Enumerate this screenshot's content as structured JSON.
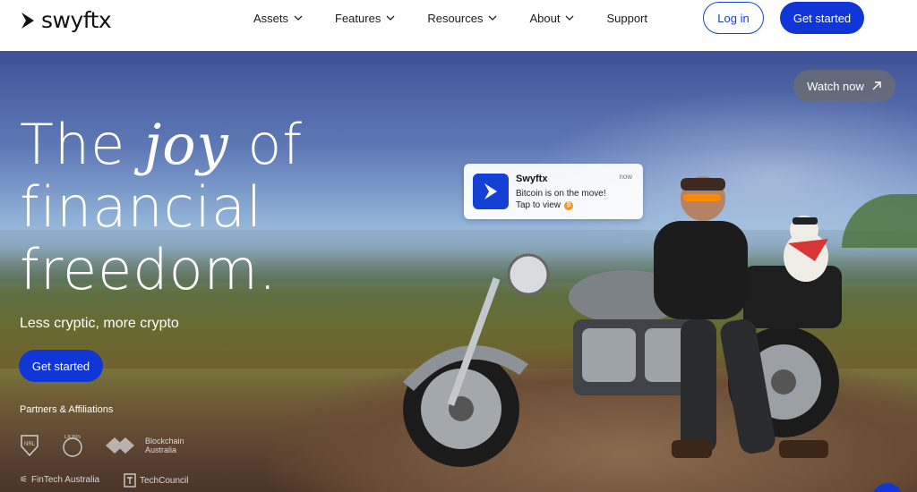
{
  "brand": {
    "name": "swyftx"
  },
  "nav": {
    "items": [
      {
        "label": "Assets",
        "dropdown": true
      },
      {
        "label": "Features",
        "dropdown": true
      },
      {
        "label": "Resources",
        "dropdown": true
      },
      {
        "label": "About",
        "dropdown": true
      },
      {
        "label": "Support",
        "dropdown": false
      }
    ],
    "login_label": "Log in",
    "get_started_label": "Get started"
  },
  "hero": {
    "headline_the": "The",
    "headline_joy": "joy",
    "headline_of": "of",
    "headline_line2": "financial",
    "headline_line3": "freedom.",
    "subtitle": "Less cryptic, more crypto",
    "cta_label": "Get started",
    "watch_label": "Watch now",
    "partners_title": "Partners & Affiliations",
    "partners": [
      {
        "name": "NRL"
      },
      {
        "name": "LIONS"
      },
      {
        "name": "Blockchain Australia"
      },
      {
        "name": "FinTech Australia"
      },
      {
        "name": "TechCouncil"
      }
    ]
  },
  "notification": {
    "app": "Swyftx",
    "time": "now",
    "line1": "Bitcoin is on the move!",
    "line2": "Tap to view"
  },
  "colors": {
    "accent": "#1036d8"
  }
}
